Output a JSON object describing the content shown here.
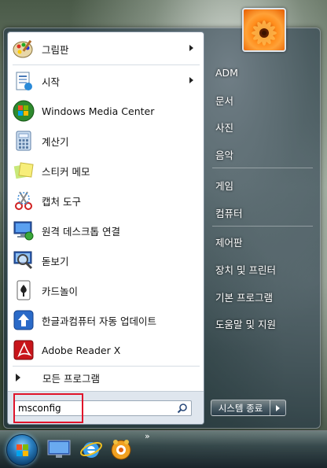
{
  "start_menu": {
    "programs": [
      {
        "label": "그림판",
        "icon": "paint-icon",
        "has_submenu": true
      },
      {
        "label": "시작",
        "icon": "getting-started-icon",
        "has_submenu": true
      },
      {
        "label": "Windows Media Center",
        "icon": "media-center-icon",
        "has_submenu": false
      },
      {
        "label": "계산기",
        "icon": "calculator-icon",
        "has_submenu": false
      },
      {
        "label": "스티커 메모",
        "icon": "sticky-notes-icon",
        "has_submenu": false
      },
      {
        "label": "캡처 도구",
        "icon": "snipping-tool-icon",
        "has_submenu": false
      },
      {
        "label": "원격 데스크톱 연결",
        "icon": "remote-desktop-icon",
        "has_submenu": false
      },
      {
        "label": "돋보기",
        "icon": "magnifier-icon",
        "has_submenu": false
      },
      {
        "label": "카드놀이",
        "icon": "solitaire-icon",
        "has_submenu": false
      },
      {
        "label": "한글과컴퓨터 자동 업데이트",
        "icon": "hancom-update-icon",
        "has_submenu": false
      },
      {
        "label": "Adobe Reader X",
        "icon": "adobe-reader-icon",
        "has_submenu": false
      }
    ],
    "all_programs_label": "모든 프로그램",
    "search": {
      "value": "msconfig",
      "placeholder": ""
    },
    "right_items": [
      {
        "label": "ADM"
      },
      {
        "label": "문서"
      },
      {
        "label": "사진"
      },
      {
        "label": "음악"
      },
      {
        "label": "게임"
      },
      {
        "label": "컴퓨터"
      },
      {
        "label": "제어판"
      },
      {
        "label": "장치 및 프린터"
      },
      {
        "label": "기본 프로그램"
      },
      {
        "label": "도움말 및 지원"
      }
    ],
    "shutdown_label": "시스템 종료"
  },
  "taskbar": {
    "more_label": "»"
  },
  "colors": {
    "highlight": "#e0142a",
    "right_text": "#ffffff"
  }
}
